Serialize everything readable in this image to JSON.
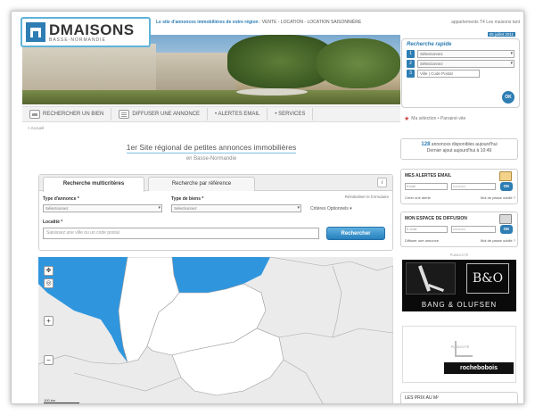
{
  "header": {
    "logo_main": "DMAISONS",
    "logo_sub": "BASSE-NORMANDIE",
    "tagline_strong": "Le site d'annonces immobilières de votre région",
    "tagline_rest": " : VENTE - LOCATION - LOCATION SAISONNIÈRE",
    "toplinks": "appartements T4  Les maisons  tant",
    "date": "05 juillet 2011"
  },
  "quick_search": {
    "title": "Recherche rapide",
    "rows": [
      {
        "num": "1",
        "value": "Sélectionnez"
      },
      {
        "num": "2",
        "value": "Sélectionnez"
      },
      {
        "num": "3",
        "value": "Ville | Code Postal"
      }
    ],
    "go_label": "OK"
  },
  "nav": {
    "items": [
      {
        "label": "RECHERCHER UN BIEN"
      },
      {
        "label": "DIFFUSER UNE ANNONCE"
      },
      {
        "label": "• ALERTES EMAIL"
      },
      {
        "label": "• SERVICES"
      }
    ],
    "selection_links": "Ma sélection  •  Parrainé-vite"
  },
  "breadcrumb": "> Accueil",
  "headline": {
    "prefix": "1er Site régional de petites annonces immobilières",
    "sub": "en Basse-Normandie"
  },
  "search_panel": {
    "tabs": [
      {
        "label": "Recherche multicritères",
        "active": true
      },
      {
        "label": "Recherche par référence",
        "active": false
      }
    ],
    "info_icon": "i",
    "reinit": "Réinitialiser le formulaire",
    "type_annonce_label": "Type d'annonce *",
    "type_annonce_value": "Sélectionnez",
    "type_bien_label": "Type de biens *",
    "type_bien_value": "Sélectionnez",
    "criteres": "Critères Optionnels ▾",
    "localite_label": "Localité *",
    "localite_placeholder": "Saisissez une ville ou un code postal",
    "search_button": "Rechercher"
  },
  "map": {
    "scale_label": "100 km",
    "zoom_in": "+",
    "zoom_out": "−",
    "colors": {
      "sea": "#2f96de",
      "land": "#ebebeb",
      "region": "#ffffff"
    }
  },
  "right": {
    "count_number": "128",
    "count_text": " annonces disponibles aujourd'hui",
    "last_update": "Dernier ajout aujourd'hui à 10:49",
    "alert_box": {
      "title": "MES ALERTES EMAIL",
      "field1": "Email",
      "field2": "••••••••••",
      "ok": "OK",
      "link1": "Créer une alerte",
      "link2": "Mot de passe oublié ?"
    },
    "diffusion_box": {
      "title": "MON ESPACE DE DIFFUSION",
      "field1": "E-mail",
      "field2": "••••••••••",
      "ok": "OK",
      "link1": "Diffuser une annonce",
      "link2": "Mot de passe oublié ?"
    },
    "pub_label": "PUBLICITÉ",
    "ad1_mark": "B&O",
    "ad1_name": "BANG & OLUFSEN",
    "pub_label2": "PUBLICITÉ",
    "ad2_name": "rochebobois",
    "prix_title": "LES PRIX AU M²"
  }
}
